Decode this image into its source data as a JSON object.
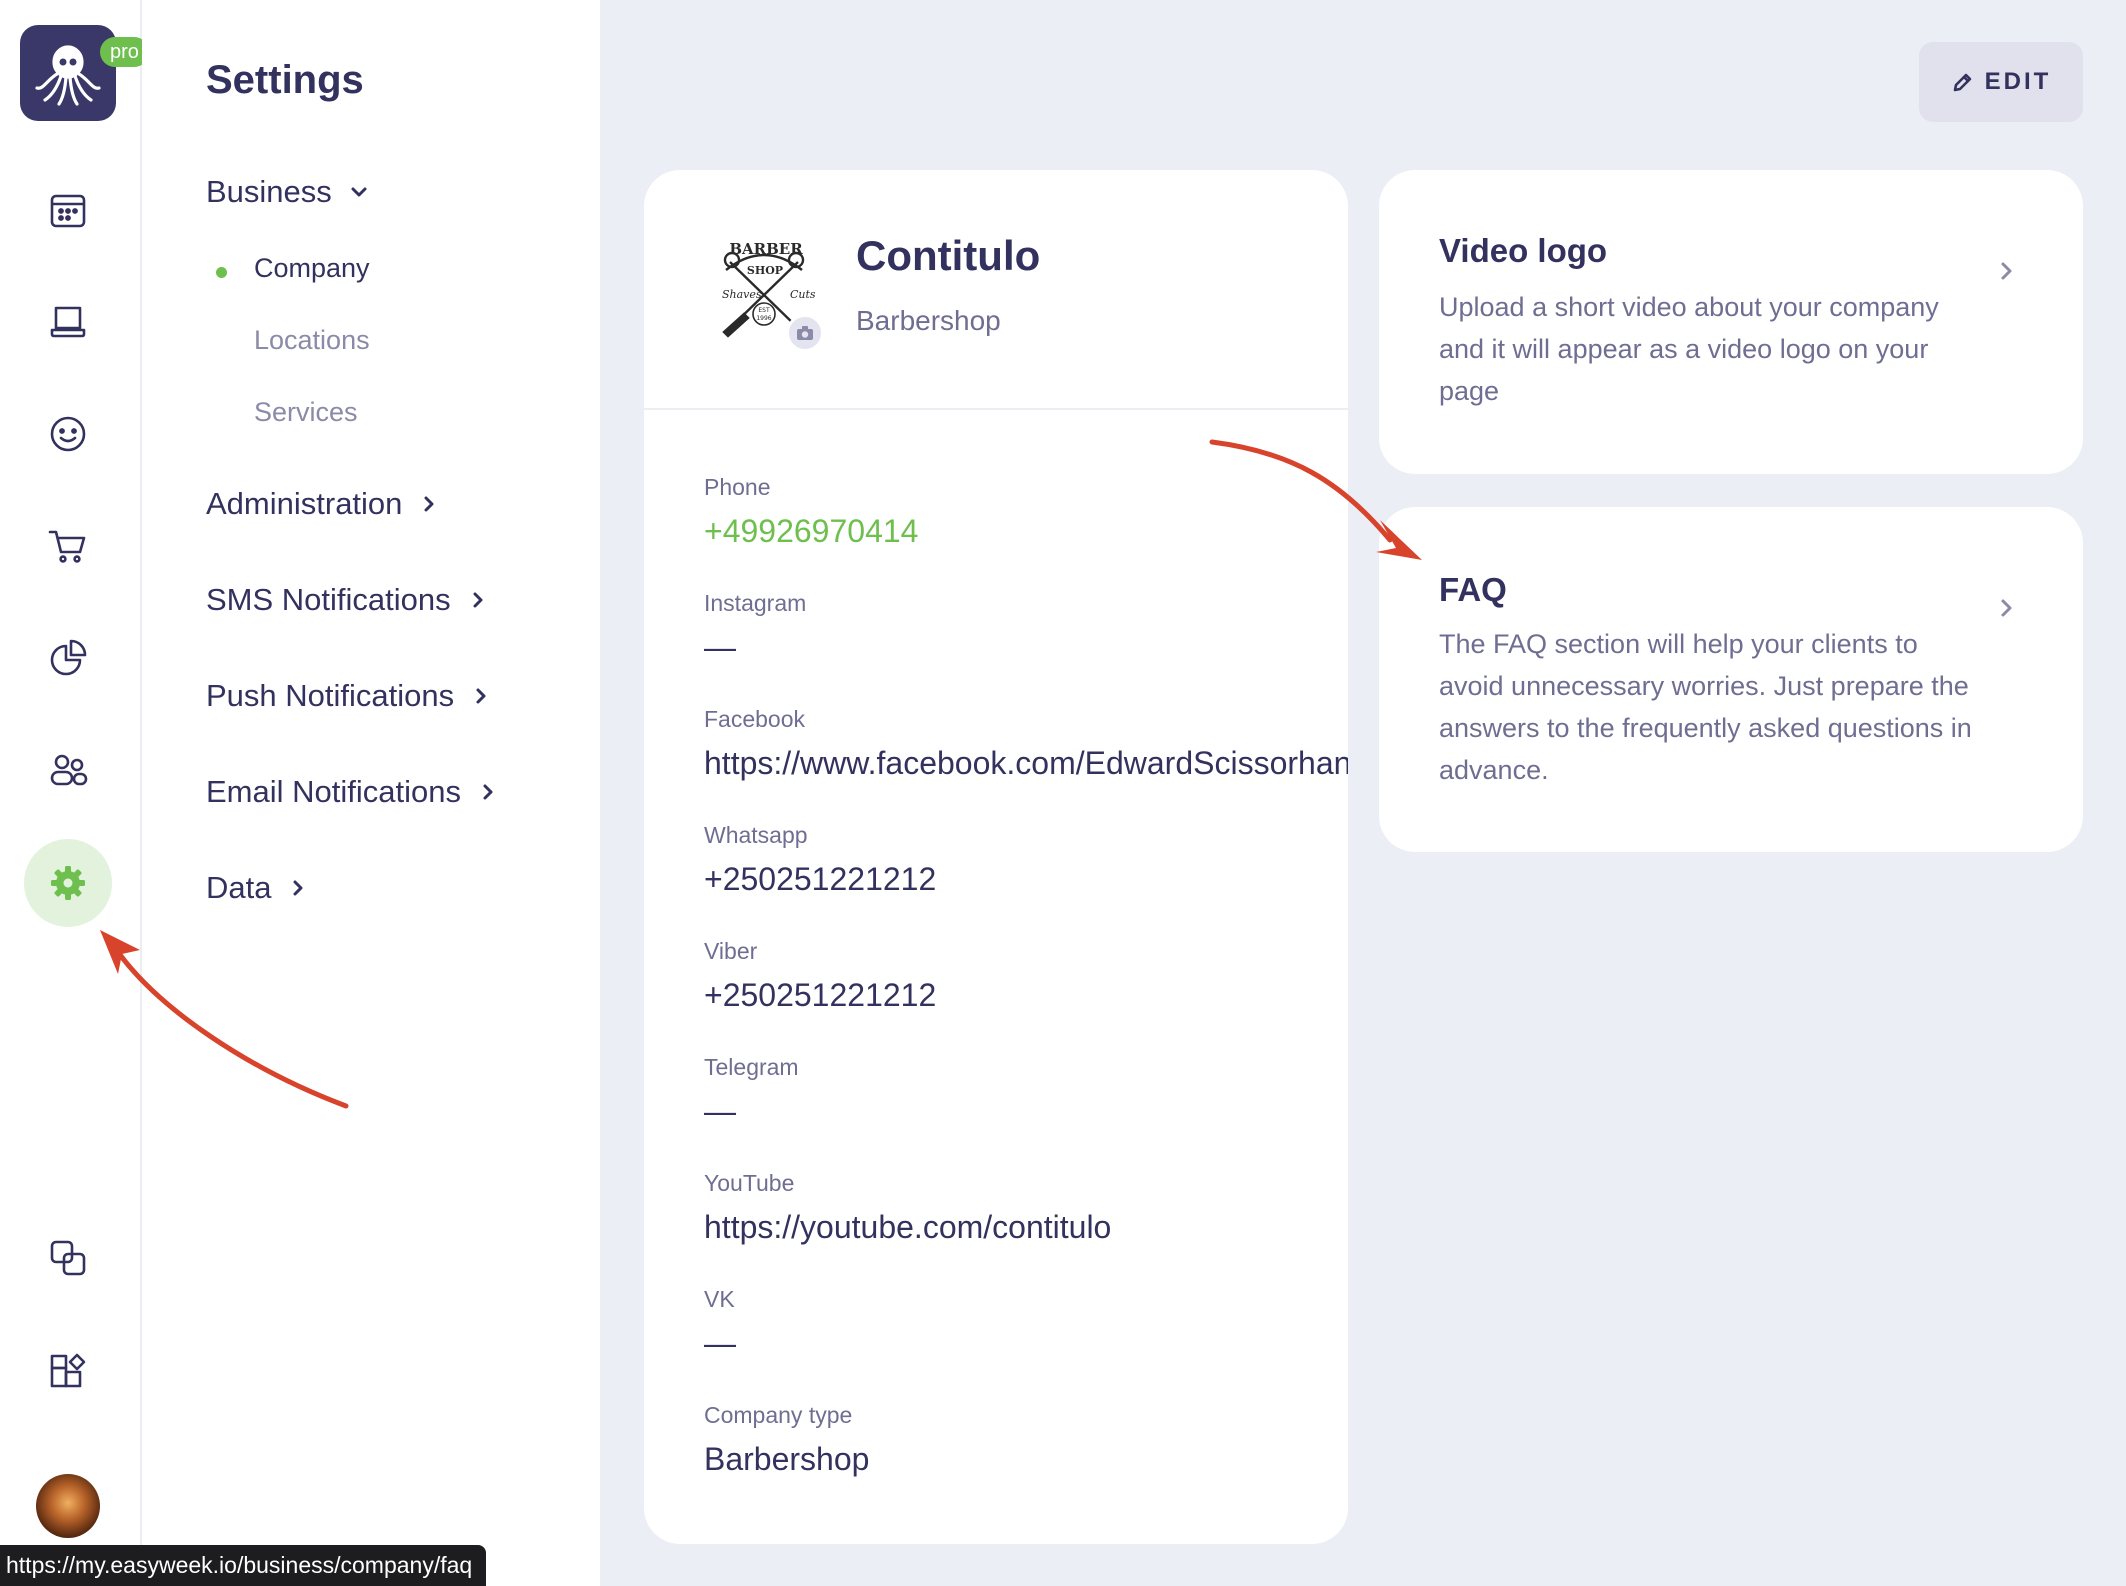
{
  "app": {
    "badge": "pro",
    "logo_icon": "octopus-icon"
  },
  "rail": {
    "icons": [
      "calendar-icon",
      "monitor-icon",
      "smiley-icon",
      "cart-icon",
      "pie-chart-icon",
      "users-icon",
      "gear-icon",
      "copy-icon",
      "widgets-icon"
    ],
    "active": "gear-icon",
    "active_color": "#6fbf4f"
  },
  "settings": {
    "title": "Settings",
    "business": {
      "label": "Business",
      "subitems": [
        {
          "label": "Company",
          "active": true
        },
        {
          "label": "Locations"
        },
        {
          "label": "Services"
        }
      ]
    },
    "sections": [
      {
        "label": "Administration"
      },
      {
        "label": "SMS Notifications"
      },
      {
        "label": "Push Notifications"
      },
      {
        "label": "Email Notifications"
      },
      {
        "label": "Data"
      }
    ]
  },
  "toolbar": {
    "edit_label": "EDIT"
  },
  "company": {
    "name": "Contitulo",
    "type_label": "Barbershop",
    "logo_text": {
      "top": "BARBER",
      "mid": "SHOP",
      "left": "Shaves",
      "right": "Cuts",
      "est": "EST",
      "year": "1996"
    },
    "fields": [
      {
        "label": "Phone",
        "value": "+49926970414",
        "accent": true
      },
      {
        "label": "Instagram",
        "value": "—"
      },
      {
        "label": "Facebook",
        "value": "https://www.facebook.com/EdwardScissorhands"
      },
      {
        "label": "Whatsapp",
        "value": "+250251221212"
      },
      {
        "label": "Viber",
        "value": "+250251221212"
      },
      {
        "label": "Telegram",
        "value": "—"
      },
      {
        "label": "YouTube",
        "value": "https://youtube.com/contitulo"
      },
      {
        "label": "VK",
        "value": "—"
      },
      {
        "label": "Company type",
        "value": "Barbershop"
      }
    ]
  },
  "cards": {
    "video_logo": {
      "title": "Video logo",
      "description": "Upload a short video about your company and it will appear as a video logo on your page"
    },
    "faq": {
      "title": "FAQ",
      "description": "The FAQ section will help your clients to avoid unnecessary worries. Just prepare the answers to the frequently asked questions in advance."
    }
  },
  "status_bar": {
    "url": "https://my.easyweek.io/business/company/faq"
  },
  "colors": {
    "primary": "#33325f",
    "accent": "#6fbf4f",
    "muted": "#6f6e92",
    "annotation": "#d8432c",
    "background": "#eceef5"
  }
}
